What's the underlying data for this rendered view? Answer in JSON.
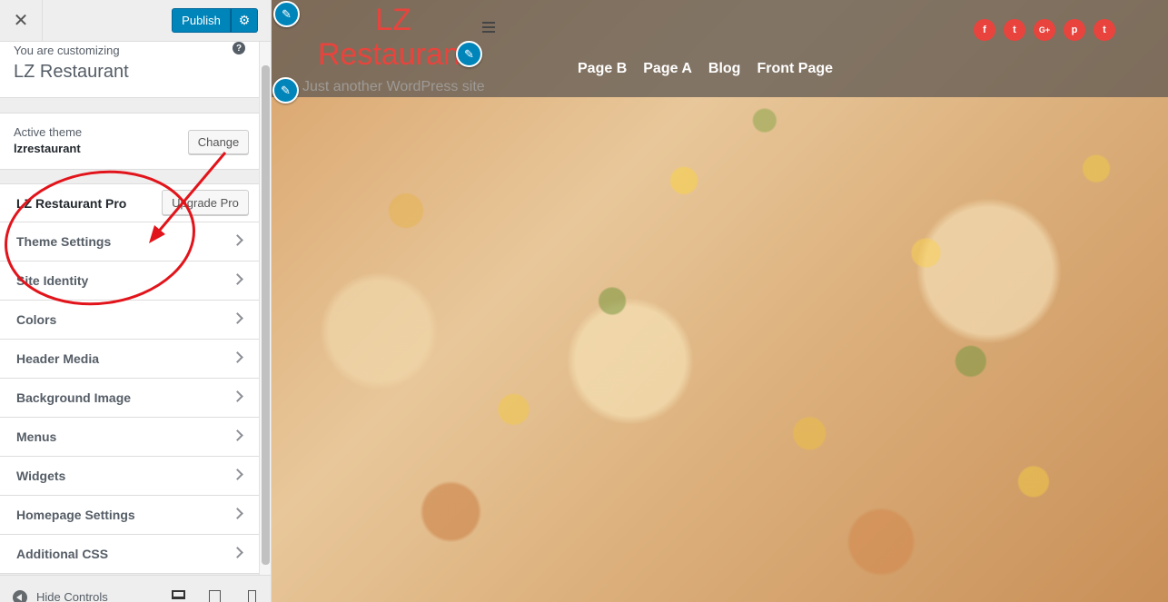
{
  "header": {
    "close_glyph": "✕",
    "publish_label": "Publish",
    "settings_glyph": "⚙"
  },
  "info": {
    "customizing_label": "You are customizing",
    "site_title": "LZ Restaurant",
    "help_glyph": "?"
  },
  "theme": {
    "active_label": "Active theme",
    "name": "lzrestaurant",
    "change_label": "Change"
  },
  "sections": {
    "items": [
      {
        "label": "LZ Restaurant Pro",
        "button": "Upgrade Pro"
      },
      {
        "label": "Theme Settings"
      },
      {
        "label": "Site Identity"
      },
      {
        "label": "Colors"
      },
      {
        "label": "Header Media"
      },
      {
        "label": "Background Image"
      },
      {
        "label": "Menus"
      },
      {
        "label": "Widgets"
      },
      {
        "label": "Homepage Settings"
      },
      {
        "label": "Additional CSS"
      }
    ]
  },
  "footer": {
    "hide_controls_label": "Hide Controls"
  },
  "preview": {
    "site_title": "LZ Restaurant",
    "tagline": "Just another WordPress site",
    "nav": [
      "Page B",
      "Page A",
      "Blog",
      "Front Page"
    ],
    "social": [
      {
        "icon": "facebook-icon",
        "glyph": "f"
      },
      {
        "icon": "twitter-icon",
        "glyph": "t"
      },
      {
        "icon": "google-plus-icon",
        "glyph": "G+"
      },
      {
        "icon": "pinterest-icon",
        "glyph": "p"
      },
      {
        "icon": "tumblr-icon",
        "glyph": "t"
      }
    ],
    "edit_glyph": "✎"
  },
  "colors": {
    "accent": "#0085ba",
    "brand_red": "#e8443d",
    "annotation": "#e2141b"
  }
}
